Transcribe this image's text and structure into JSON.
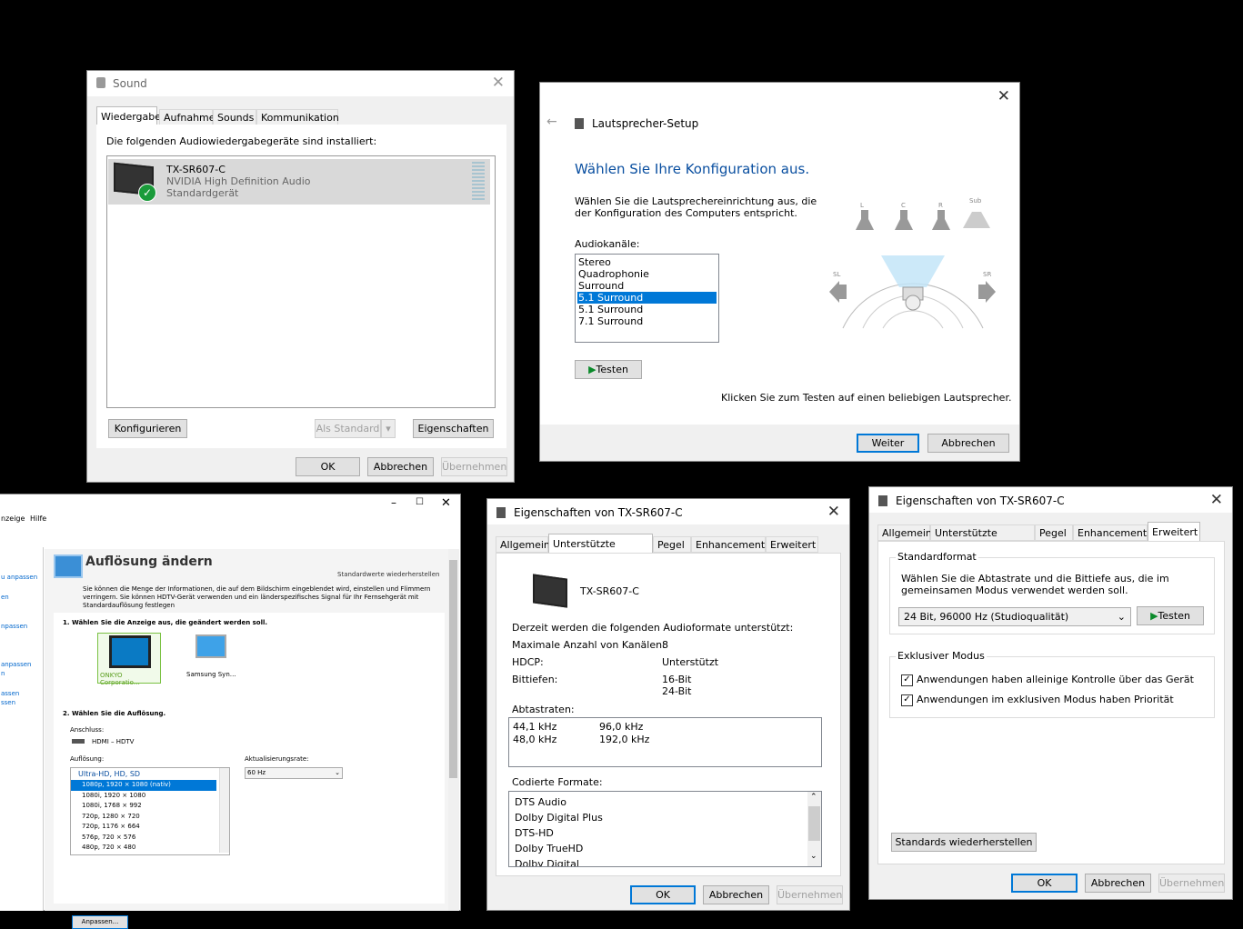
{
  "sound": {
    "title": "Sound",
    "tabs": [
      "Wiedergabe",
      "Aufnahme",
      "Sounds",
      "Kommunikation"
    ],
    "intro": "Die folgenden Audiowiedergabegeräte sind installiert:",
    "device": {
      "name": "TX-SR607-C",
      "driver": "NVIDIA High Definition Audio",
      "status": "Standardgerät"
    },
    "configure": "Konfigurieren",
    "set_default": "Als Standard",
    "properties": "Eigenschaften",
    "ok": "OK",
    "cancel": "Abbrechen",
    "apply": "Übernehmen"
  },
  "speaker_setup": {
    "title": "Lautsprecher-Setup",
    "heading": "Wählen Sie Ihre Konfiguration aus.",
    "desc_line1": "Wählen Sie die Lautsprechereinrichtung aus, die",
    "desc_line2": "der Konfiguration des Computers entspricht.",
    "channels_label": "Audiokanäle:",
    "channels": [
      "Stereo",
      "Quadrophonie",
      "Surround",
      "5.1 Surround",
      "5.1 Surround",
      "7.1 Surround"
    ],
    "selected_index": 3,
    "test": "Testen",
    "hint": "Klicken Sie zum Testen auf einen beliebigen Lautsprecher.",
    "next": "Weiter",
    "cancel": "Abbrechen",
    "speaker_labels": [
      "L",
      "C",
      "R",
      "Sub",
      "SL",
      "SR"
    ]
  },
  "nvidia": {
    "menu": [
      "nzeige",
      "Hilfe"
    ],
    "heading": "Auflösung ändern",
    "restore": "Standardwerte wiederherstellen",
    "desc": "Sie können die Menge der Informationen, die auf dem Bildschirm eingeblendet wird, einstellen und Flimmern verringern. Sie können HDTV-Gerät verwenden und ein länderspezifisches Signal für Ihr Fernsehgerät mit Standardauflösung festlegen",
    "step1": "1. Wählen Sie die Anzeige aus, die geändert werden soll.",
    "display1": "ONKYO Corporatio…",
    "display2": "Samsung Syn…",
    "step2": "2. Wählen Sie die Auflösung.",
    "connection_label": "Anschluss:",
    "connection": "HDMI – HDTV",
    "resolution_label": "Auflösung:",
    "refresh_label": "Aktualisierungsrate:",
    "refresh_value": "60 Hz",
    "res_group": "Ultra-HD, HD, SD",
    "resolutions": [
      "1080p, 1920 × 1080 (nativ)",
      "1080i, 1920 × 1080",
      "1080i, 1768 × 992",
      "720p, 1280 × 720",
      "720p, 1176 × 664",
      "576p, 720 × 576",
      "480p, 720 × 480"
    ],
    "customize": "Anpassen...",
    "sidebar": [
      "u anpassen",
      "en",
      "npassen",
      "anpassen",
      "n",
      "assen",
      "ssen"
    ]
  },
  "props1": {
    "title": "Eigenschaften von TX-SR607-C",
    "tabs": [
      "Allgemein",
      "Unterstützte Formate",
      "Pegel",
      "Enhancements",
      "Erweitert"
    ],
    "device": "TX-SR607-C",
    "intro": "Derzeit werden die folgenden Audioformate unterstützt:",
    "rows": [
      {
        "label": "Maximale Anzahl von Kanälen:",
        "value": "8"
      },
      {
        "label": "HDCP:",
        "value": "Unterstützt"
      },
      {
        "label": "Bittiefen:",
        "value": "16-Bit"
      }
    ],
    "bitdepth2": "24-Bit",
    "rates_label": "Abtastraten:",
    "rates": [
      "44,1 kHz",
      "96,0 kHz",
      "48,0 kHz",
      "192,0 kHz"
    ],
    "coded_label": "Codierte Formate:",
    "coded": [
      "DTS Audio",
      "Dolby Digital Plus",
      "DTS-HD",
      "Dolby TrueHD",
      "Dolby Digital"
    ],
    "ok": "OK",
    "cancel": "Abbrechen",
    "apply": "Übernehmen"
  },
  "props2": {
    "title": "Eigenschaften von TX-SR607-C",
    "tabs": [
      "Allgemein",
      "Unterstützte Formate",
      "Pegel",
      "Enhancements",
      "Erweitert"
    ],
    "default_format_label": "Standardformat",
    "default_format_desc1": "Wählen Sie die Abtastrate und die Bittiefe aus, die im",
    "default_format_desc2": "gemeinsamen Modus verwendet werden soll.",
    "format_value": "24 Bit, 96000 Hz (Studioqualität)",
    "test": "Testen",
    "exclusive_label": "Exklusiver Modus",
    "exclusive1": "Anwendungen haben alleinige Kontrolle über das Gerät",
    "exclusive2": "Anwendungen im exklusiven Modus haben Priorität",
    "restore": "Standards wiederherstellen",
    "ok": "OK",
    "cancel": "Abbrechen",
    "apply": "Übernehmen"
  }
}
